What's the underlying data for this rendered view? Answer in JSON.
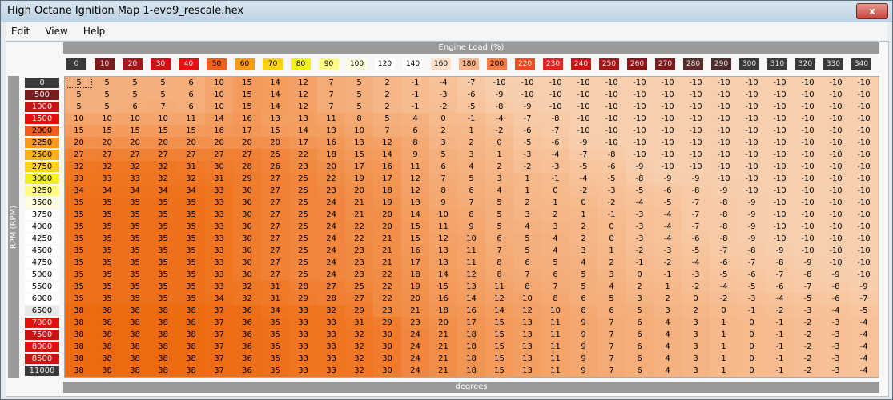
{
  "window": {
    "title": "High Octane Ignition Map 1-evo9_rescale.hex",
    "close_label": "x"
  },
  "menu": [
    "Edit",
    "View",
    "Help"
  ],
  "x_axis_title": "Engine Load (%)",
  "y_axis_title": "RPM (RPM)",
  "bottom_label": "degrees",
  "columns": [
    "0",
    "10",
    "20",
    "30",
    "40",
    "50",
    "60",
    "70",
    "80",
    "90",
    "100",
    "120",
    "140",
    "160",
    "180",
    "200",
    "220",
    "230",
    "240",
    "250",
    "260",
    "270",
    "280",
    "290",
    "300",
    "310",
    "320",
    "330",
    "340"
  ],
  "rows": [
    "0",
    "500",
    "1000",
    "1500",
    "2000",
    "2250",
    "2500",
    "2750",
    "3000",
    "3250",
    "3500",
    "3750",
    "4000",
    "4250",
    "4500",
    "4750",
    "5000",
    "5500",
    "6000",
    "6500",
    "7000",
    "7500",
    "8000",
    "8500",
    "11000"
  ],
  "table": [
    [
      5,
      5,
      5,
      5,
      6,
      10,
      15,
      14,
      12,
      7,
      5,
      2,
      -1,
      -4,
      -7,
      -10,
      -10,
      -10,
      -10,
      -10,
      -10,
      -10,
      -10,
      -10,
      -10,
      -10,
      -10,
      -10,
      -10
    ],
    [
      5,
      5,
      5,
      5,
      6,
      10,
      15,
      14,
      12,
      7,
      5,
      2,
      -1,
      -3,
      -6,
      -9,
      -10,
      -10,
      -10,
      -10,
      -10,
      -10,
      -10,
      -10,
      -10,
      -10,
      -10,
      -10,
      -10
    ],
    [
      5,
      5,
      6,
      7,
      6,
      10,
      15,
      14,
      12,
      7,
      5,
      2,
      -1,
      -2,
      -5,
      -8,
      -9,
      -10,
      -10,
      -10,
      -10,
      -10,
      -10,
      -10,
      -10,
      -10,
      -10,
      -10,
      -10
    ],
    [
      10,
      10,
      10,
      10,
      11,
      14,
      16,
      13,
      13,
      11,
      8,
      5,
      4,
      0,
      -1,
      -4,
      -7,
      -8,
      -10,
      -10,
      -10,
      -10,
      -10,
      -10,
      -10,
      -10,
      -10,
      -10,
      -10
    ],
    [
      15,
      15,
      15,
      15,
      15,
      16,
      17,
      15,
      14,
      13,
      10,
      7,
      6,
      2,
      1,
      -2,
      -6,
      -7,
      -10,
      -10,
      -10,
      -10,
      -10,
      -10,
      -10,
      -10,
      -10,
      -10,
      -10
    ],
    [
      20,
      20,
      20,
      20,
      20,
      20,
      20,
      20,
      17,
      16,
      13,
      12,
      8,
      3,
      2,
      0,
      -5,
      -6,
      -9,
      -10,
      -10,
      -10,
      -10,
      -10,
      -10,
      -10,
      -10,
      -10,
      -10
    ],
    [
      27,
      27,
      27,
      27,
      27,
      27,
      27,
      25,
      22,
      18,
      15,
      14,
      9,
      5,
      3,
      1,
      -3,
      -4,
      -7,
      -8,
      -10,
      -10,
      -10,
      -10,
      -10,
      -10,
      -10,
      -10,
      -10
    ],
    [
      32,
      32,
      32,
      32,
      31,
      30,
      28,
      26,
      23,
      20,
      17,
      16,
      11,
      6,
      4,
      2,
      -2,
      -3,
      -5,
      -6,
      -9,
      -10,
      -10,
      -10,
      -10,
      -10,
      -10,
      -10,
      -10
    ],
    [
      33,
      33,
      33,
      32,
      32,
      31,
      29,
      27,
      25,
      22,
      19,
      17,
      12,
      7,
      5,
      3,
      1,
      -1,
      -4,
      -5,
      -8,
      -9,
      -9,
      -10,
      -10,
      -10,
      -10,
      -10,
      -10
    ],
    [
      34,
      34,
      34,
      34,
      34,
      33,
      30,
      27,
      25,
      23,
      20,
      18,
      12,
      8,
      6,
      4,
      1,
      0,
      -2,
      -3,
      -5,
      -6,
      -8,
      -9,
      -10,
      -10,
      -10,
      -10,
      -10
    ],
    [
      35,
      35,
      35,
      35,
      35,
      33,
      30,
      27,
      25,
      24,
      21,
      19,
      13,
      9,
      7,
      5,
      2,
      1,
      0,
      -2,
      -4,
      -5,
      -7,
      -8,
      -9,
      -10,
      -10,
      -10,
      -10
    ],
    [
      35,
      35,
      35,
      35,
      35,
      33,
      30,
      27,
      25,
      24,
      21,
      20,
      14,
      10,
      8,
      5,
      3,
      2,
      1,
      -1,
      -3,
      -4,
      -7,
      -8,
      -9,
      -10,
      -10,
      -10,
      -10
    ],
    [
      35,
      35,
      35,
      35,
      35,
      33,
      30,
      27,
      25,
      24,
      22,
      20,
      15,
      11,
      9,
      5,
      4,
      3,
      2,
      0,
      -3,
      -4,
      -7,
      -8,
      -9,
      -10,
      -10,
      -10,
      -10
    ],
    [
      35,
      35,
      35,
      35,
      35,
      33,
      30,
      27,
      25,
      24,
      22,
      21,
      15,
      12,
      10,
      6,
      5,
      4,
      2,
      0,
      -3,
      -4,
      -6,
      -8,
      -9,
      -10,
      -10,
      -10,
      -10
    ],
    [
      35,
      35,
      35,
      35,
      35,
      33,
      30,
      27,
      25,
      24,
      23,
      21,
      16,
      13,
      11,
      7,
      5,
      4,
      3,
      1,
      -2,
      -3,
      -5,
      -7,
      -8,
      -9,
      -10,
      -10,
      -10
    ],
    [
      35,
      35,
      35,
      35,
      35,
      33,
      30,
      27,
      25,
      24,
      23,
      21,
      17,
      13,
      11,
      8,
      6,
      5,
      4,
      2,
      -1,
      -2,
      -4,
      -6,
      -7,
      -8,
      -9,
      -10,
      -10
    ],
    [
      35,
      35,
      35,
      35,
      35,
      33,
      30,
      27,
      25,
      24,
      23,
      22,
      18,
      14,
      12,
      8,
      7,
      6,
      5,
      3,
      0,
      -1,
      -3,
      -5,
      -6,
      -7,
      -8,
      -9,
      -10
    ],
    [
      35,
      35,
      35,
      35,
      35,
      33,
      32,
      31,
      28,
      27,
      25,
      22,
      19,
      15,
      13,
      11,
      8,
      7,
      5,
      4,
      2,
      1,
      -2,
      -4,
      -5,
      -6,
      -7,
      -8,
      -9
    ],
    [
      35,
      35,
      35,
      35,
      35,
      34,
      32,
      31,
      29,
      28,
      27,
      22,
      20,
      16,
      14,
      12,
      10,
      8,
      6,
      5,
      3,
      2,
      0,
      -2,
      -3,
      -4,
      -5,
      -6,
      -7
    ],
    [
      38,
      38,
      38,
      38,
      38,
      37,
      36,
      34,
      33,
      32,
      29,
      23,
      21,
      18,
      16,
      14,
      12,
      10,
      8,
      6,
      5,
      3,
      2,
      0,
      -1,
      -2,
      -3,
      -4,
      -5
    ],
    [
      38,
      38,
      38,
      38,
      38,
      37,
      36,
      35,
      33,
      33,
      31,
      29,
      23,
      20,
      17,
      15,
      13,
      11,
      9,
      7,
      6,
      4,
      3,
      1,
      0,
      -1,
      -2,
      -3,
      -4
    ],
    [
      38,
      38,
      38,
      38,
      38,
      37,
      36,
      35,
      33,
      33,
      32,
      30,
      24,
      21,
      18,
      15,
      13,
      11,
      9,
      7,
      6,
      4,
      3,
      1,
      0,
      -1,
      -2,
      -3,
      -4
    ],
    [
      38,
      38,
      38,
      38,
      38,
      37,
      36,
      35,
      33,
      33,
      32,
      30,
      24,
      21,
      18,
      15,
      13,
      11,
      9,
      7,
      6,
      4,
      3,
      1,
      0,
      -1,
      -2,
      -3,
      -4
    ],
    [
      38,
      38,
      38,
      38,
      38,
      37,
      36,
      35,
      33,
      33,
      32,
      30,
      24,
      21,
      18,
      15,
      13,
      11,
      9,
      7,
      6,
      4,
      3,
      1,
      0,
      -1,
      -2,
      -3,
      -4
    ],
    [
      38,
      38,
      38,
      38,
      38,
      37,
      36,
      35,
      33,
      33,
      32,
      30,
      24,
      21,
      18,
      15,
      13,
      11,
      9,
      7,
      6,
      4,
      3,
      1,
      0,
      -1,
      -2,
      -3,
      -4
    ]
  ],
  "selected_cell": {
    "row": 0,
    "col": 0
  },
  "colors": {
    "column_header_colors": [
      "#3a3a3a",
      "#7a1c1c",
      "#a01818",
      "#c81414",
      "#e61010",
      "#f25c1c",
      "#f79a1a",
      "#fdd21a",
      "#f2f21a",
      "#fffb86",
      "#fffde0",
      "#ffffff",
      "#ffffff",
      "#ffe0c8",
      "#f9b48a",
      "#f37d48",
      "#f04a24",
      "#e02424",
      "#c81414",
      "#a01818",
      "#8a1414",
      "#7a1c1c",
      "#5a2a2a",
      "#4a2a2a",
      "#3a3a3a",
      "#3a3a3a",
      "#3a3a3a",
      "#3a3a3a",
      "#3a3a3a"
    ],
    "row_header_colors": [
      "#3a3a3a",
      "#7a1c1c",
      "#c81414",
      "#e61010",
      "#f25c1c",
      "#f79a1a",
      "#f7b21a",
      "#fdd21a",
      "#f2f21a",
      "#fffb86",
      "#fffde0",
      "#ffffff",
      "#ffffff",
      "#ffffff",
      "#ffffff",
      "#ffffff",
      "#ffffff",
      "#ffffff",
      "#ffffff",
      "#e8e8e8",
      "#e61010",
      "#c81414",
      "#e61010",
      "#c81414",
      "#3a3a3a"
    ]
  }
}
